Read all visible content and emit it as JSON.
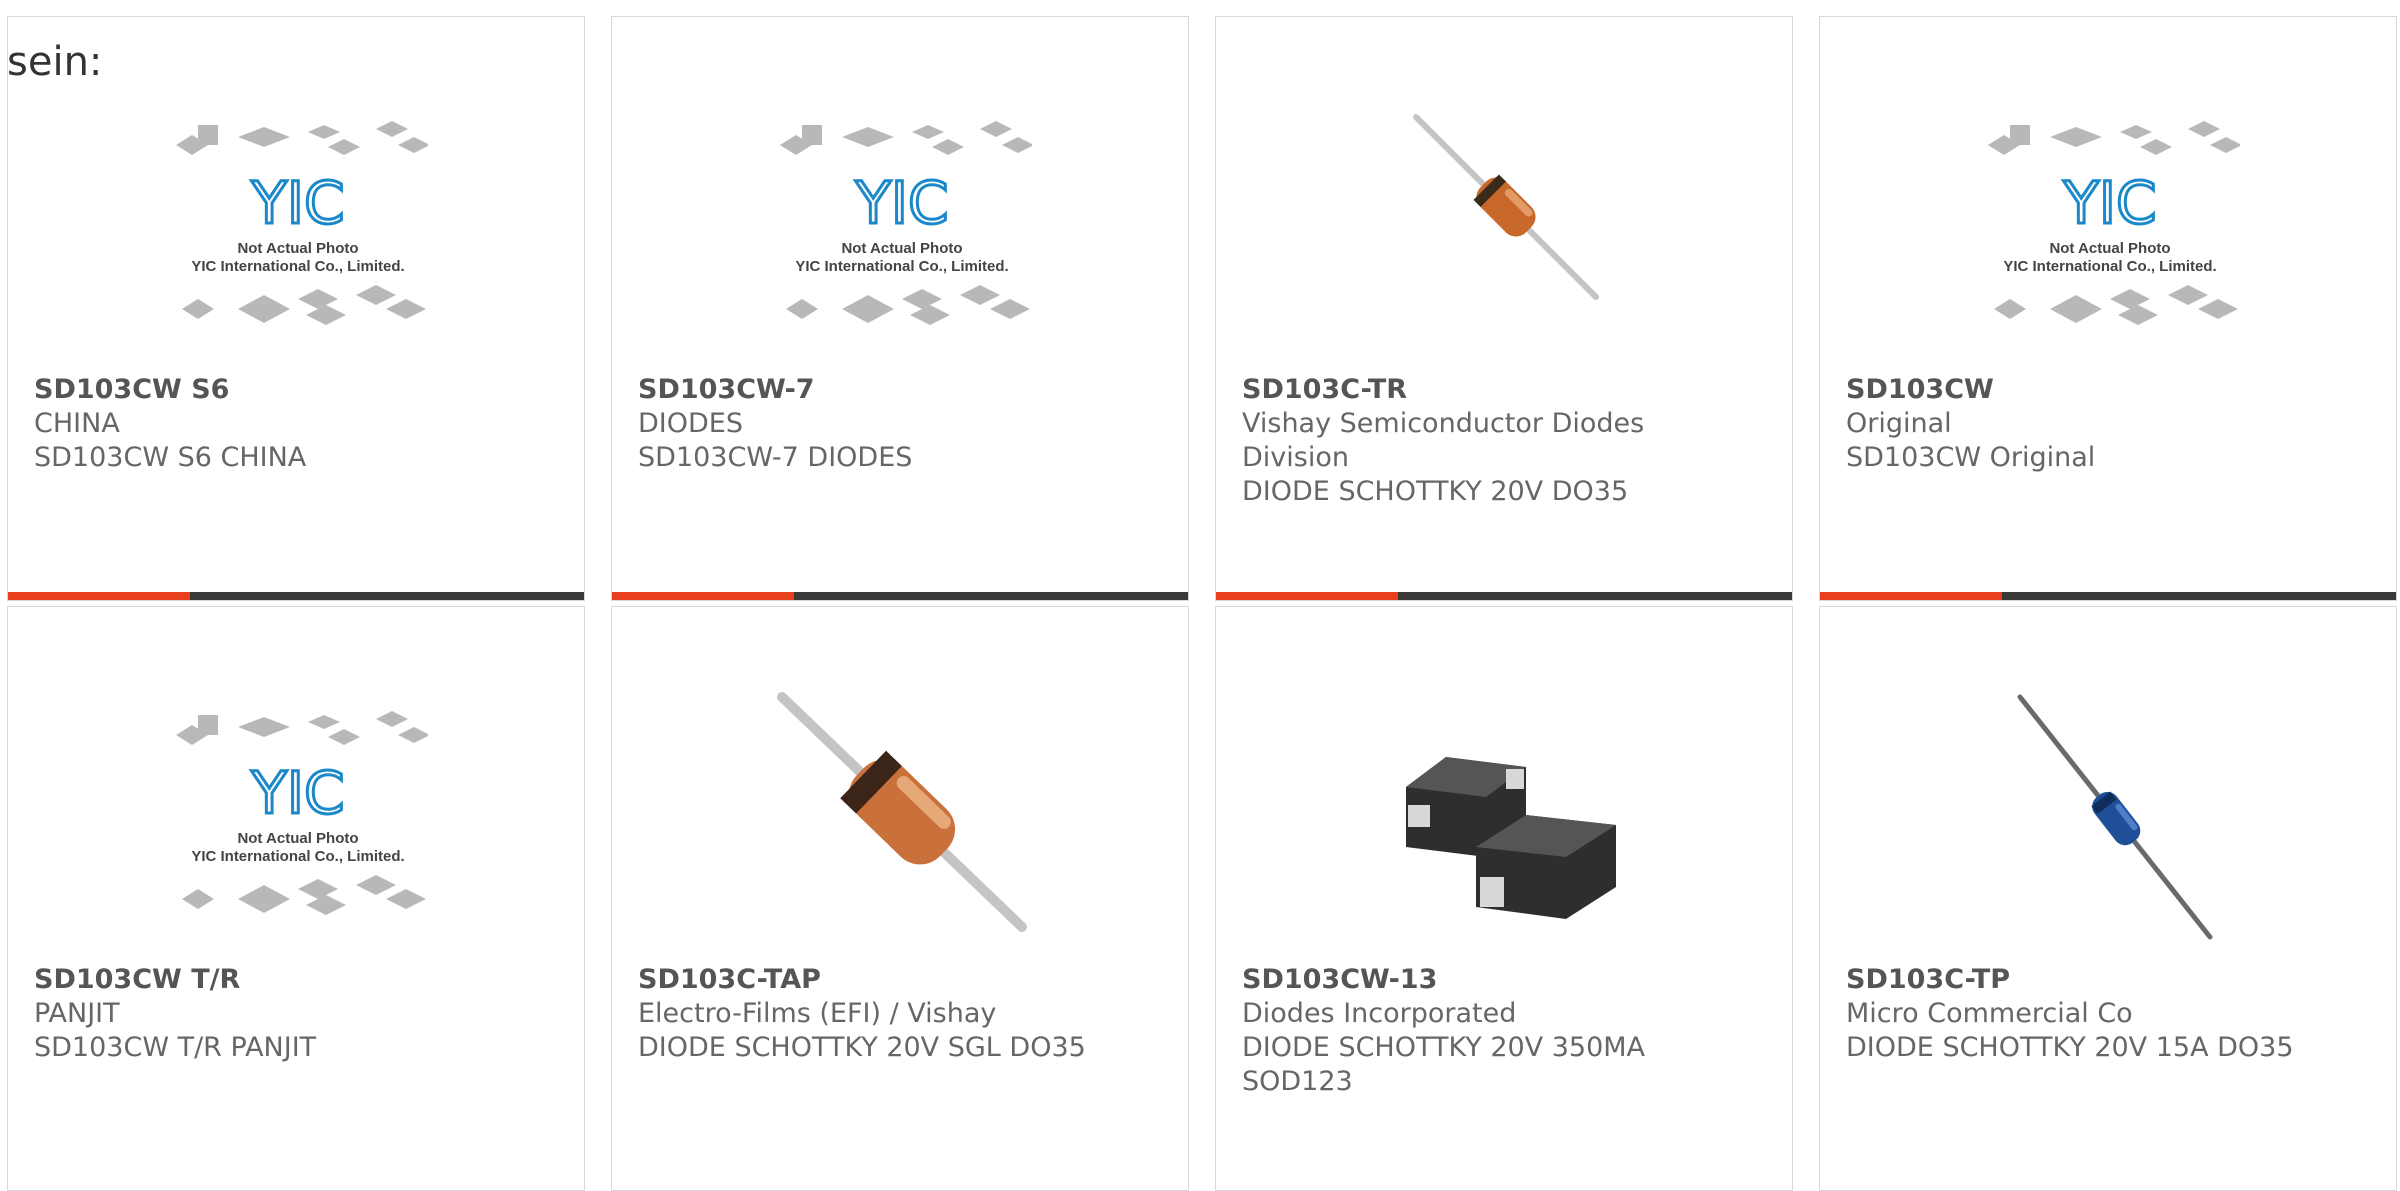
{
  "page": {
    "heading": "sein:"
  },
  "placeholder": {
    "title": "Not Actual Photo",
    "company": "YIC International Co., Limited.",
    "logo": "YIC"
  },
  "colors": {
    "accent": "#e8401c",
    "bar": "#3a3a3a",
    "logo": "#1a88c9"
  },
  "products": [
    {
      "part": "SD103CW S6",
      "line1": "CHINA",
      "line2": "SD103CW S6 CHINA",
      "line3": "",
      "image": "yic-placeholder",
      "accent_bar": true
    },
    {
      "part": "SD103CW-7",
      "line1": "DIODES",
      "line2": "SD103CW-7 DIODES",
      "line3": "",
      "image": "yic-placeholder",
      "accent_bar": true
    },
    {
      "part": "SD103C-TR",
      "line1": "Vishay Semiconductor Diodes",
      "line2": "Division",
      "line3": "DIODE SCHOTTKY 20V DO35",
      "image": "axial-diode-orange",
      "accent_bar": true
    },
    {
      "part": "SD103CW",
      "line1": "Original",
      "line2": "SD103CW Original",
      "line3": "",
      "image": "yic-placeholder",
      "accent_bar": true
    },
    {
      "part": "SD103CW T/R",
      "line1": "PANJIT",
      "line2": "SD103CW T/R PANJIT",
      "line3": "",
      "image": "yic-placeholder",
      "accent_bar": false
    },
    {
      "part": "SD103C-TAP",
      "line1": "Electro-Films (EFI) / Vishay",
      "line2": "DIODE SCHOTTKY 20V SGL DO35",
      "line3": "",
      "image": "axial-diode-orange-large",
      "accent_bar": false
    },
    {
      "part": "SD103CW-13",
      "line1": "Diodes Incorporated",
      "line2": "DIODE SCHOTTKY 20V 350MA",
      "line3": "SOD123",
      "image": "sod123-package",
      "accent_bar": false
    },
    {
      "part": "SD103C-TP",
      "line1": "Micro Commercial Co",
      "line2": "DIODE SCHOTTKY 20V 15A DO35",
      "line3": "",
      "image": "axial-diode-blue",
      "accent_bar": false
    }
  ]
}
